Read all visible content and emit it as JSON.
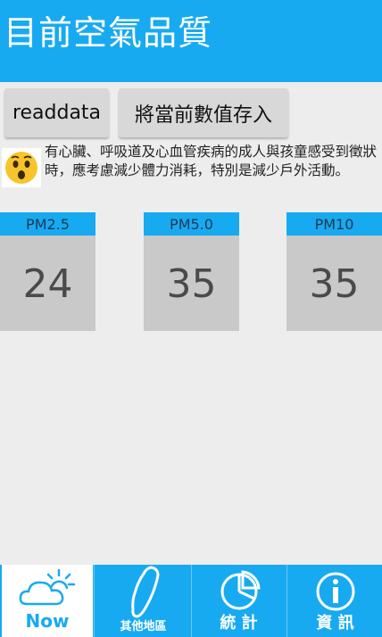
{
  "app": {
    "title": "目前空氣品質"
  },
  "buttons": {
    "read_label": "readdata",
    "store_label": "將當前數值存入"
  },
  "advice": {
    "icon": "surprised-face-icon",
    "text": "有心臟、呼吸道及心血管疾病的成人與孩童感受到徵狀時，應考慮減少體力消耗，特別是減少戶外活動。"
  },
  "readings": [
    {
      "label": "PM2.5",
      "value": "24"
    },
    {
      "label": "PM5.0",
      "value": "35"
    },
    {
      "label": "PM10",
      "value": "35"
    }
  ],
  "nav": {
    "items": [
      {
        "label": "Now",
        "icon": "weather-cloud-sun-icon",
        "active": true
      },
      {
        "label": "其他地區",
        "icon": "taiwan-map-icon",
        "active": false
      },
      {
        "label": "統 計",
        "icon": "pie-chart-icon",
        "active": false
      },
      {
        "label": "資 訊",
        "icon": "info-icon",
        "active": false
      }
    ]
  },
  "colors": {
    "accent": "#18aaf0",
    "background": "#ededed",
    "card": "#c9c9c9"
  }
}
